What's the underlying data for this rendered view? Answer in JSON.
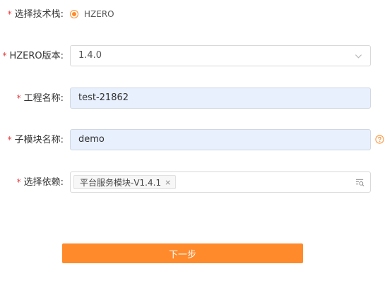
{
  "form": {
    "tech_stack": {
      "label": "选择技术栈:",
      "option": "HZERO",
      "selected": true
    },
    "hzero_version": {
      "label": "HZERO版本:",
      "value": "1.4.0",
      "icon": "chevron-down-icon"
    },
    "project_name": {
      "label": "工程名称:",
      "value": "test-21862"
    },
    "submodule_name": {
      "label": "子模块名称:",
      "value": "demo",
      "help_icon": "question-circle-icon"
    },
    "dependencies": {
      "label": "选择依赖:",
      "tags": [
        "平台服务模块-V1.4.1"
      ],
      "remove_symbol": "×",
      "icon": "lookup-icon"
    }
  },
  "required_mark": "*",
  "actions": {
    "next_label": "下一步"
  },
  "colors": {
    "accent": "#ff8a2b",
    "required": "#e5383b",
    "filled_input_bg": "#e8f0fe"
  }
}
